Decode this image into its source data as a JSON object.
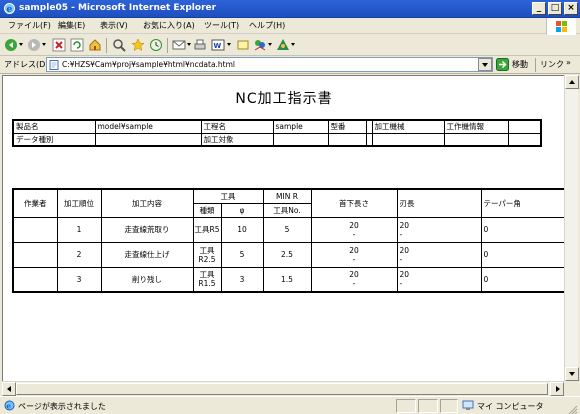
{
  "window": {
    "title": "sample05 - Microsoft Internet Explorer",
    "minimize": "_",
    "maximize": "□",
    "close": "×"
  },
  "menu": [
    "ファイル(F)",
    "編集(E)",
    "表示(V)",
    "お気に入り(A)",
    "ツール(T)",
    "ヘルプ(H)"
  ],
  "toolbar": {
    "icons": [
      "back-icon",
      "forward-icon",
      "stop-icon",
      "refresh-icon",
      "home-icon",
      "search-icon",
      "favorites-icon",
      "history-icon",
      "mail-icon",
      "print-icon",
      "edit-icon",
      "discuss-icon",
      "messenger-icon",
      "research-icon"
    ]
  },
  "address": {
    "label": "アドレス(D)",
    "url": "C:¥HZS¥Cam¥proj¥sample¥html¥ncdata.html",
    "go_label": "移動",
    "links_label": "リンク",
    "links_arrow": "»"
  },
  "document": {
    "title": "NC加工指示書",
    "info": {
      "row1": [
        "製品名",
        "model¥sample",
        "工程名",
        "sample",
        "型番",
        "",
        "加工機械",
        "工作機情報",
        ""
      ],
      "row2": [
        "データ種別",
        "",
        "加工対象",
        "",
        "",
        "",
        "",
        "",
        ""
      ]
    },
    "process": {
      "headers": {
        "worker": "作業者",
        "order": "加工順位",
        "content": "加工内容",
        "tool": "工具",
        "tool_type": "種類",
        "tool_phi": "φ",
        "minr": "MIN R",
        "minr_sub": "工具No.",
        "neck": "首下長さ",
        "blade": "刃長",
        "taper": "テーパー角"
      },
      "rows": [
        {
          "worker": "",
          "order": "1",
          "content": "走査線荒取り",
          "type": "工具R5",
          "type2": "",
          "phi": "10",
          "minr": "5",
          "neck": "20",
          "neck2": "-",
          "blade": "20",
          "blade2": "-",
          "taper": "0"
        },
        {
          "worker": "",
          "order": "2",
          "content": "走査線仕上げ",
          "type": "工具",
          "type2": "R2.5",
          "phi": "5",
          "minr": "2.5",
          "neck": "20",
          "neck2": "-",
          "blade": "20",
          "blade2": "-",
          "taper": "0"
        },
        {
          "worker": "",
          "order": "3",
          "content": "削り残し",
          "type": "工具",
          "type2": "R1.5",
          "phi": "3",
          "minr": "1.5",
          "neck": "20",
          "neck2": "-",
          "blade": "20",
          "blade2": "-",
          "taper": "0"
        }
      ]
    }
  },
  "status": {
    "text": "ページが表示されました",
    "zone": "マイ コンピュータ"
  },
  "colors": {
    "titlebar": "#2c63d8",
    "chrome": "#ece9d8",
    "page": "#ffffff"
  }
}
